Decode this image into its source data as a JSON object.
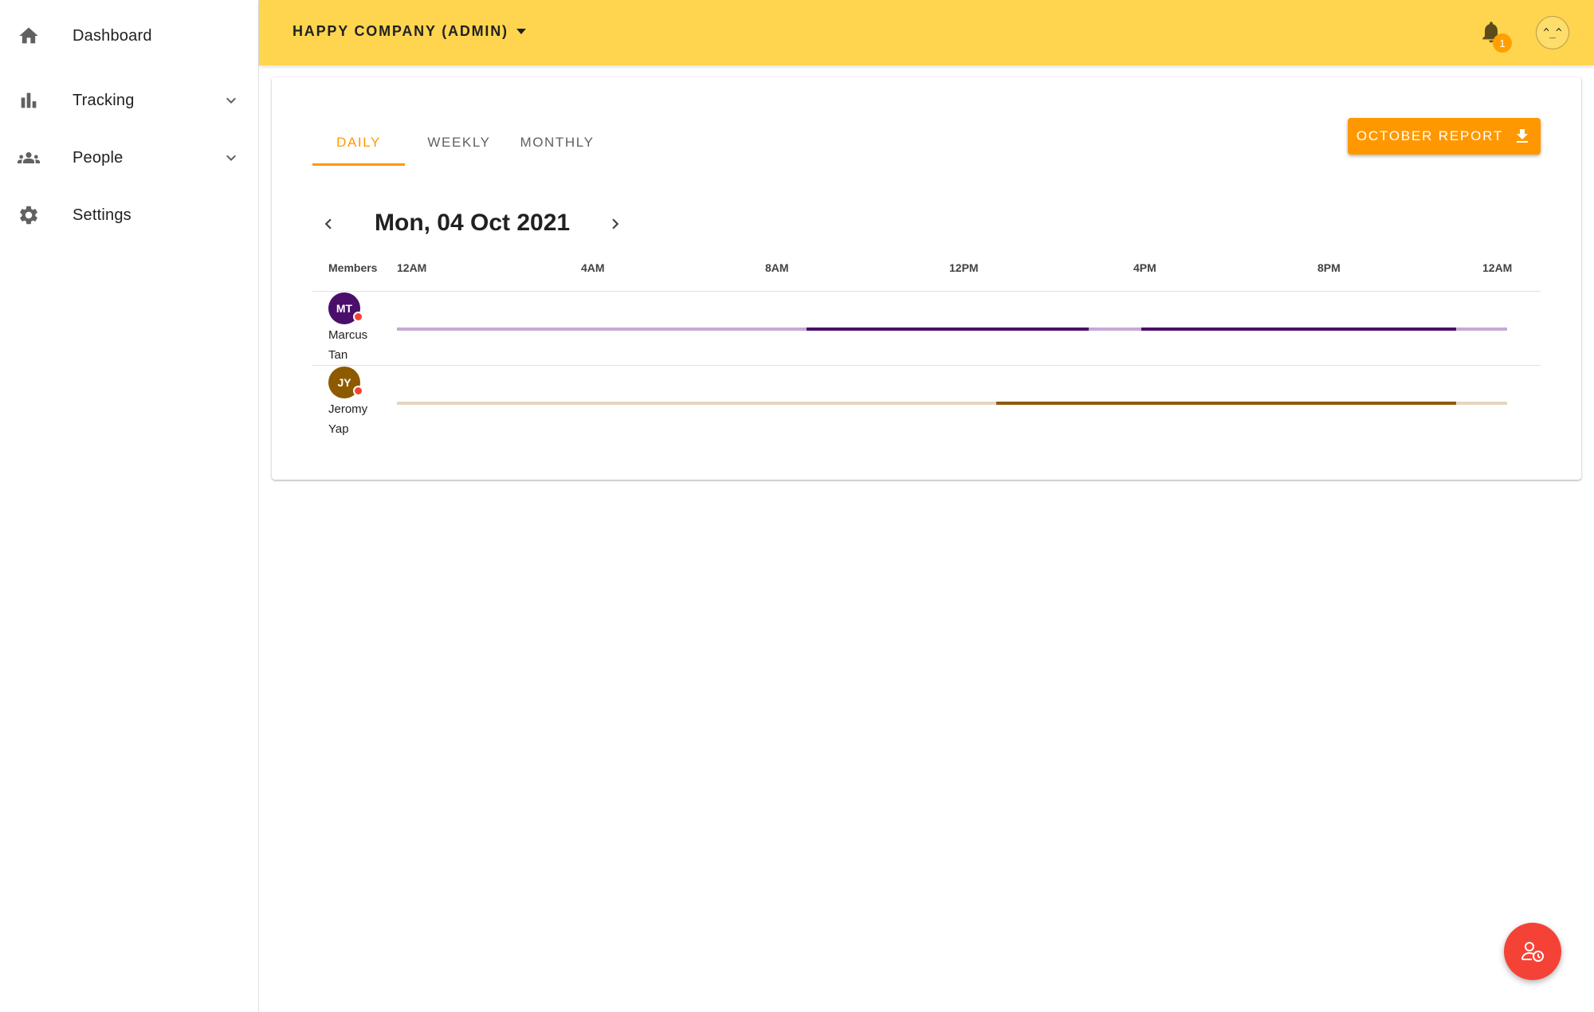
{
  "sidebar": {
    "items": [
      {
        "label": "Dashboard",
        "icon": "home-icon"
      },
      {
        "label": "Tracking",
        "icon": "bar-chart-icon",
        "expandable": true
      },
      {
        "label": "People",
        "icon": "people-icon",
        "expandable": true
      },
      {
        "label": "Settings",
        "icon": "gear-icon"
      }
    ]
  },
  "topbar": {
    "company": "HAPPY COMPANY (ADMIN)",
    "notification_count": "1",
    "user_avatar_text": "^_^"
  },
  "tabs": [
    {
      "label": "DAILY",
      "active": true
    },
    {
      "label": "WEEKLY",
      "active": false
    },
    {
      "label": "MONTHLY",
      "active": false
    }
  ],
  "report_button": "OCTOBER REPORT",
  "date_title": "Mon, 04 Oct 2021",
  "timeline": {
    "members_header": "Members",
    "ticks": [
      "12AM",
      "4AM",
      "8AM",
      "12PM",
      "4PM",
      "8PM",
      "12AM"
    ],
    "members": [
      {
        "initials": "MT",
        "name_line1": "Marcus",
        "name_line2": "Tan",
        "color": "#4a0e6b",
        "track_color": "#c5a9d4",
        "active_hours": [
          [
            8.85,
            14.95
          ],
          [
            16.1,
            22.9
          ]
        ]
      },
      {
        "initials": "JY",
        "name_line1": "Jeromy",
        "name_line2": "Yap",
        "color": "#8d5a00",
        "track_color": "#e4d6c1",
        "active_hours": [
          [
            12.95,
            22.9
          ]
        ]
      }
    ]
  },
  "colors": {
    "accent": "#ff9800",
    "topbar": "#ffd54f",
    "fab": "#f44336",
    "status_offline": "#f44336"
  }
}
